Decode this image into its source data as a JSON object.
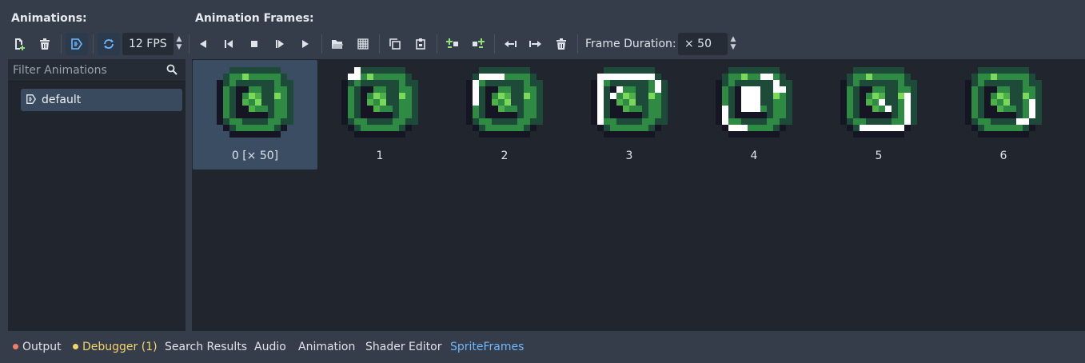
{
  "left": {
    "heading": "Animations:",
    "filter_placeholder": "Filter Animations",
    "items": [
      {
        "label": "default"
      }
    ]
  },
  "right": {
    "heading": "Animation Frames:",
    "frame_duration_label": "Frame Duration:",
    "frame_duration_value": "× 50"
  },
  "toolbar": {
    "fps_value": "12 FPS"
  },
  "frames": [
    {
      "label": "0 [× 50]"
    },
    {
      "label": "1"
    },
    {
      "label": "2"
    },
    {
      "label": "3"
    },
    {
      "label": "4"
    },
    {
      "label": "5"
    },
    {
      "label": "6"
    }
  ],
  "bottom_tabs": [
    {
      "label": "Output",
      "dot_color": "#f07d6b"
    },
    {
      "label": "Debugger (1)",
      "dot_color": "#f5d36b"
    },
    {
      "label": "Search Results"
    },
    {
      "label": "Audio"
    },
    {
      "label": "Animation"
    },
    {
      "label": "Shader Editor"
    },
    {
      "label": "SpriteFrames"
    }
  ],
  "colors": {
    "accent": "#6fb7ff",
    "debugger_text": "#f5d36b",
    "active_tab_text": "#6fb7ff"
  }
}
